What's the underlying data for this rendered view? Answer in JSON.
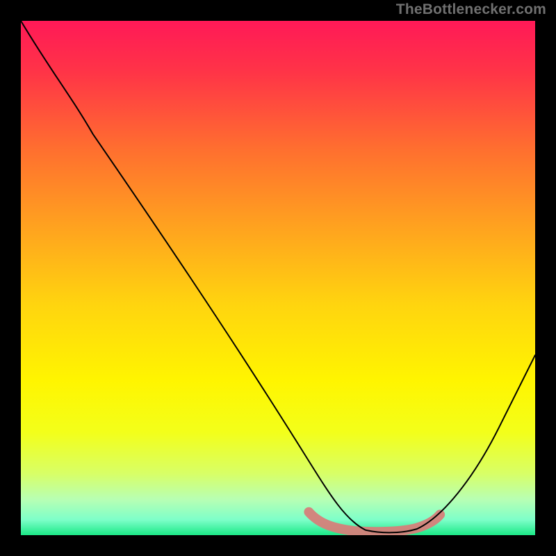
{
  "watermark": "TheBottlenecker.com",
  "chart_data": {
    "type": "line",
    "title": "",
    "xlabel": "",
    "ylabel": "",
    "xlim": [
      0,
      100
    ],
    "ylim": [
      0,
      100
    ],
    "x": [
      0,
      5,
      10,
      15,
      20,
      25,
      30,
      35,
      40,
      45,
      50,
      55,
      60,
      63,
      66,
      70,
      74,
      78,
      82,
      86,
      90,
      95,
      100
    ],
    "values": [
      100,
      93,
      84,
      76,
      68,
      60,
      52,
      44,
      37,
      30,
      23,
      16,
      9,
      4,
      1.5,
      0.5,
      0.5,
      1,
      4,
      9,
      15,
      24,
      35
    ],
    "highlight_segment": {
      "x": [
        55,
        58,
        62,
        66,
        70,
        74,
        78,
        81
      ],
      "y": [
        4,
        2,
        1,
        0.7,
        0.6,
        0.8,
        1.6,
        3.2
      ]
    },
    "gradient_stops": [
      {
        "offset": 0.0,
        "color": "#ff1957"
      },
      {
        "offset": 0.1,
        "color": "#ff3447"
      },
      {
        "offset": 0.25,
        "color": "#ff6f2f"
      },
      {
        "offset": 0.4,
        "color": "#ffa21f"
      },
      {
        "offset": 0.55,
        "color": "#ffd40f"
      },
      {
        "offset": 0.7,
        "color": "#fff500"
      },
      {
        "offset": 0.8,
        "color": "#f3ff1a"
      },
      {
        "offset": 0.88,
        "color": "#d8ff66"
      },
      {
        "offset": 0.93,
        "color": "#b8ffb3"
      },
      {
        "offset": 0.97,
        "color": "#7effc9"
      },
      {
        "offset": 1.0,
        "color": "#1be886"
      }
    ]
  }
}
